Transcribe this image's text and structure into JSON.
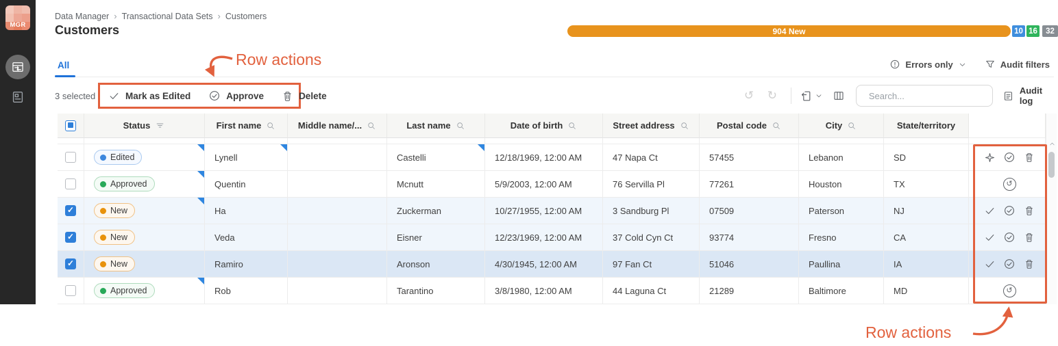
{
  "sidebar": {
    "logo_text": "MGR",
    "nav_icons": [
      "data-table-icon",
      "catalog-icon"
    ]
  },
  "breadcrumb": {
    "items": [
      "Data Manager",
      "Transactional Data Sets",
      "Customers"
    ],
    "separator": "›"
  },
  "header": {
    "title": "Customers",
    "progress": {
      "label": "904 New",
      "bar_color": "#e8931d",
      "badges": [
        {
          "value": "10",
          "color": "#3f8edd"
        },
        {
          "value": "16",
          "color": "#2fb45c"
        },
        {
          "value": "32",
          "color": "#878d93"
        }
      ]
    }
  },
  "tabs": {
    "all": "All"
  },
  "filters": {
    "errors_only": "Errors only",
    "audit_filters": "Audit filters"
  },
  "action_bar": {
    "selected_count": "3 selected",
    "mark_as_edited": "Mark as Edited",
    "approve": "Approve",
    "delete": "Delete",
    "search_placeholder": "Search...",
    "audit_log": "Audit log"
  },
  "annotations": {
    "top": "Row actions",
    "bottom": "Row actions",
    "color": "#e2613e"
  },
  "table": {
    "columns": [
      "Status",
      "First name",
      "Middle name/...",
      "Last name",
      "Date of birth",
      "Street address",
      "Postal code",
      "City",
      "State/territory"
    ],
    "rows": [
      {
        "status": "Edited",
        "status_type": "edited",
        "selected": false,
        "first_name": "Lynell",
        "middle_name": "",
        "last_name": "Castelli",
        "date_of_birth": "12/18/1969, 12:00 AM",
        "street_address": "47 Napa Ct",
        "postal_code": "57455",
        "city": "Lebanon",
        "state": "SD",
        "actions": [
          "sparkle",
          "approve",
          "delete"
        ],
        "edited_cells": [
          "status",
          "first_name",
          "last_name"
        ]
      },
      {
        "status": "Approved",
        "status_type": "approved",
        "selected": false,
        "first_name": "Quentin",
        "middle_name": "",
        "last_name": "Mcnutt",
        "date_of_birth": "5/9/2003, 12:00 AM",
        "street_address": "76 Servilla Pl",
        "postal_code": "77261",
        "city": "Houston",
        "state": "TX",
        "actions": [
          "revert"
        ],
        "edited_cells": [
          "status"
        ]
      },
      {
        "status": "New",
        "status_type": "new",
        "selected": true,
        "first_name": "Ha",
        "middle_name": "",
        "last_name": "Zuckerman",
        "date_of_birth": "10/27/1955, 12:00 AM",
        "street_address": "3 Sandburg Pl",
        "postal_code": "07509",
        "city": "Paterson",
        "state": "NJ",
        "actions": [
          "mark-edited",
          "approve",
          "delete"
        ],
        "edited_cells": [
          "status"
        ]
      },
      {
        "status": "New",
        "status_type": "new",
        "selected": true,
        "first_name": "Veda",
        "middle_name": "",
        "last_name": "Eisner",
        "date_of_birth": "12/23/1969, 12:00 AM",
        "street_address": "37 Cold Cyn Ct",
        "postal_code": "93774",
        "city": "Fresno",
        "state": "CA",
        "actions": [
          "mark-edited",
          "approve",
          "delete"
        ],
        "edited_cells": []
      },
      {
        "status": "New",
        "status_type": "new",
        "selected": true,
        "first_name": "Ramiro",
        "middle_name": "",
        "last_name": "Aronson",
        "date_of_birth": "4/30/1945, 12:00 AM",
        "street_address": "97 Fan Ct",
        "postal_code": "51046",
        "city": "Paullina",
        "state": "IA",
        "actions": [
          "mark-edited",
          "approve",
          "delete"
        ],
        "edited_cells": [],
        "hovered": true
      },
      {
        "status": "Approved",
        "status_type": "approved",
        "selected": false,
        "first_name": "Rob",
        "middle_name": "",
        "last_name": "Tarantino",
        "date_of_birth": "3/8/1980, 12:00 AM",
        "street_address": "44 Laguna Ct",
        "postal_code": "21289",
        "city": "Baltimore",
        "state": "MD",
        "actions": [
          "revert"
        ],
        "edited_cells": [
          "status"
        ]
      }
    ]
  },
  "icons": {
    "undo": "↺",
    "redo": "↻",
    "revert": "↺",
    "export": "export-document",
    "columns": "column-layout",
    "search": "magnifier",
    "audit_log": "document-lines",
    "errors_only": "exclamation-circle",
    "audit_filters": "funnel",
    "mark_edited": "checkmark",
    "approve": "circle-checkmark",
    "delete": "trash-can",
    "sparkle": "four-point-star",
    "status_filter": "filter-lines",
    "column_search": "magnifier",
    "scroll_up": "chevron-up"
  },
  "colors": {
    "annotation": "#e2613e",
    "accent_blue": "#1f72d9",
    "progress_orange": "#e8931d",
    "edited_marker": "#2f86e0",
    "selected_row": "#f0f6fc",
    "selected_row_dark": "#dbe7f5",
    "status_edited_dot": "#3d87dd",
    "status_approved_dot": "#27a958",
    "status_new_dot": "#e8920c",
    "sidebar_bg": "#272727"
  }
}
